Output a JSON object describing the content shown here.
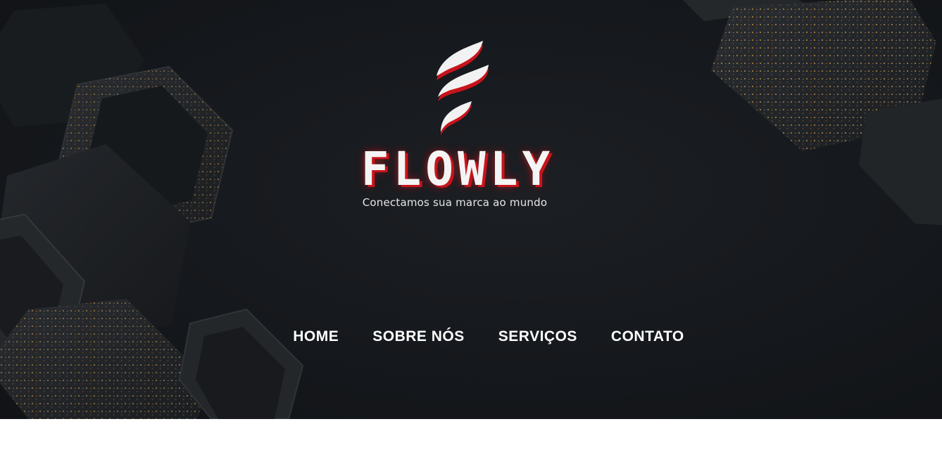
{
  "brand": {
    "name": "FLOWLY",
    "tagline": "Conectamos sua marca ao mundo",
    "logo_icon": "flame-f-icon",
    "colors": {
      "red": "#c8141b",
      "white": "#f4f4f4",
      "background": "#15181c"
    }
  },
  "nav": {
    "items": [
      {
        "label": "HOME"
      },
      {
        "label": "SOBRE NÓS"
      },
      {
        "label": "SERVIÇOS"
      },
      {
        "label": "CONTATO"
      }
    ]
  }
}
